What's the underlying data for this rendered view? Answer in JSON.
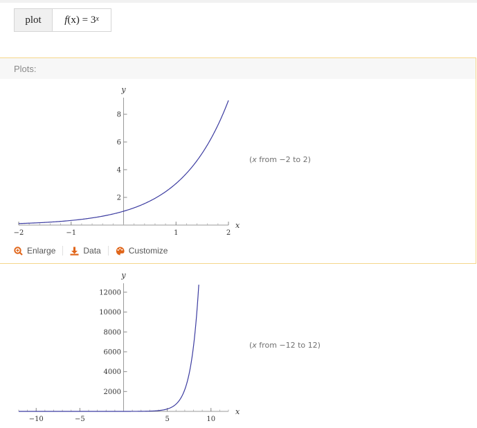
{
  "input": {
    "command": "plot",
    "func": "f",
    "arg": "(x) = 3",
    "exponent": "x"
  },
  "pod": {
    "title": "Plots:"
  },
  "actions": [
    {
      "label": "Enlarge",
      "icon": "enlarge-magnifier-icon"
    },
    {
      "label": "Data",
      "icon": "download-icon"
    },
    {
      "label": "Customize",
      "icon": "palette-icon"
    }
  ],
  "plot_notes": [
    {
      "prefix": "(",
      "var": "x",
      "text": " from −2 to 2)"
    },
    {
      "prefix": "(",
      "var": "x",
      "text": " from −12 to 12)"
    }
  ],
  "colors": {
    "curve": "#3b3ba0",
    "pod_border": "#f5d68a",
    "action_icon": "#e0661b"
  },
  "chart_data": [
    {
      "type": "line",
      "function": "3^x",
      "xlabel": "x",
      "ylabel": "y",
      "xlim": [
        -2,
        2
      ],
      "ylim": [
        0,
        9
      ],
      "x_ticks": [
        -2,
        -1,
        1,
        2
      ],
      "x_tick_labels": [
        "−2",
        "−1",
        "1",
        "2"
      ],
      "y_ticks": [
        2,
        4,
        6,
        8
      ],
      "y_tick_labels": [
        "2",
        "4",
        "6",
        "8"
      ],
      "series": [
        {
          "x": [
            -2,
            -1.5,
            -1,
            -0.5,
            0,
            0.5,
            1,
            1.5,
            2
          ],
          "y": [
            0.111,
            0.192,
            0.333,
            0.577,
            1,
            1.732,
            3,
            5.196,
            9
          ]
        }
      ],
      "grid": false
    },
    {
      "type": "line",
      "function": "3^x",
      "xlabel": "x",
      "ylabel": "y",
      "xlim": [
        -12,
        12
      ],
      "ylim": [
        0,
        12800
      ],
      "x_ticks": [
        -10,
        -5,
        5,
        10
      ],
      "x_tick_labels": [
        "−10",
        "−5",
        "5",
        "10"
      ],
      "y_ticks": [
        2000,
        4000,
        6000,
        8000,
        10000,
        12000
      ],
      "y_tick_labels": [
        "2000",
        "4000",
        "6000",
        "8000",
        "10000",
        "12000"
      ],
      "series": [
        {
          "x": [
            -12,
            -6,
            0,
            4,
            5,
            6,
            7,
            8,
            8.6
          ],
          "y": [
            0,
            0.001,
            1,
            81,
            243,
            729,
            2187,
            6561,
            12800
          ]
        }
      ],
      "grid": false
    }
  ]
}
